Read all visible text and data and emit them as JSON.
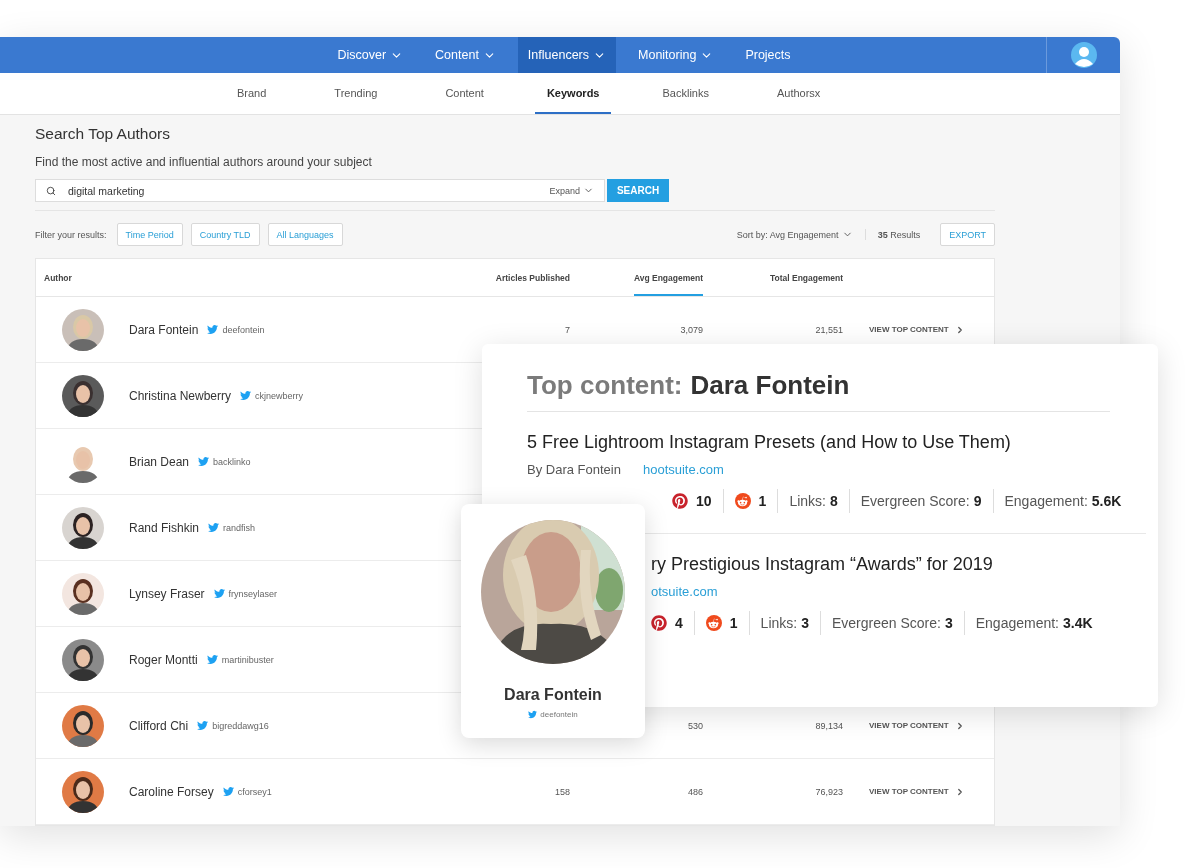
{
  "nav": {
    "items": [
      {
        "label": "Discover",
        "has_menu": true,
        "selected": false
      },
      {
        "label": "Content",
        "has_menu": true,
        "selected": false
      },
      {
        "label": "Influencers",
        "has_menu": true,
        "selected": true
      },
      {
        "label": "Monitoring",
        "has_menu": true,
        "selected": false
      },
      {
        "label": "Projects",
        "has_menu": false,
        "selected": false
      }
    ]
  },
  "subnav": {
    "tabs": [
      {
        "label": "Brand",
        "selected": false
      },
      {
        "label": "Trending",
        "selected": false
      },
      {
        "label": "Content",
        "selected": false
      },
      {
        "label": "Keywords",
        "selected": true
      },
      {
        "label": "Backlinks",
        "selected": false
      },
      {
        "label": "Authorsx",
        "selected": false
      }
    ]
  },
  "page": {
    "title": "Search Top Authors",
    "subtitle": "Find the most active and influential authors around your subject"
  },
  "search": {
    "value": "digital marketing",
    "expand": "Expand",
    "button": "SEARCH"
  },
  "filters": {
    "label": "Filter your results:",
    "buttons": [
      "Time Period",
      "Country TLD",
      "All Languages"
    ],
    "sort": "Sort by: Avg Engagement",
    "results": "**35** Results",
    "export": "EXPORT"
  },
  "table": {
    "columns": [
      {
        "label": "Author",
        "selected": false
      },
      {
        "label": "Articles Published",
        "selected": false
      },
      {
        "label": "Avg Engagement",
        "selected": true
      },
      {
        "label": "Total Engagement",
        "selected": false
      }
    ],
    "rows": [
      {
        "name": "Dara Fontein",
        "handle": "deefontein",
        "articles": "7",
        "avg": "3,079",
        "total": "21,551",
        "action": "VIEW TOP CONTENT"
      },
      {
        "name": "Christina Newberry",
        "handle": "ckjnewberry"
      },
      {
        "name": "Brian Dean",
        "handle": "backlinko"
      },
      {
        "name": "Rand Fishkin",
        "handle": "randfish"
      },
      {
        "name": "Lynsey Fraser",
        "handle": "frynseylaser"
      },
      {
        "name": "Roger Montti",
        "handle": "martinibuster"
      },
      {
        "name": "Clifford Chi",
        "handle": "bigreddawg16",
        "avg": "530",
        "total": "89,134",
        "action": "VIEW TOP CONTENT"
      },
      {
        "name": "Caroline Forsey",
        "handle": "cforsey1",
        "articles": "158",
        "avg": "486",
        "total": "76,923",
        "action": "VIEW TOP CONTENT"
      }
    ]
  },
  "top_content": {
    "label": "Top content:",
    "name": "Dara Fontein",
    "articles": [
      {
        "title": "5 Free Lightroom Instagram Presets (and How to Use Them)",
        "byline": "By Dara Fontein",
        "domain": "hootsuite.com",
        "stats": [
          {
            "kind": "pinterest",
            "value": "10"
          },
          {
            "kind": "reddit",
            "value": "1"
          },
          {
            "kind": "metric",
            "label": "Links:",
            "value": "8"
          },
          {
            "kind": "metric",
            "label": "Evergreen Score:",
            "value": "9"
          },
          {
            "kind": "metric",
            "label": "Engagement:",
            "value": "5.6K"
          }
        ]
      },
      {
        "title": "ry Prestigious Instagram “Awards” for 2019",
        "domain": "otsuite.com",
        "stats": [
          {
            "kind": "pinterest",
            "value": "4"
          },
          {
            "kind": "reddit",
            "value": "1"
          },
          {
            "kind": "metric",
            "label": "Links:",
            "value": "3"
          },
          {
            "kind": "metric",
            "label": "Evergreen Score:",
            "value": "3"
          },
          {
            "kind": "metric",
            "label": "Engagement:",
            "value": "3.4K"
          }
        ]
      }
    ]
  },
  "profile": {
    "name": "Dara Fontein",
    "handle": "deefontein"
  }
}
